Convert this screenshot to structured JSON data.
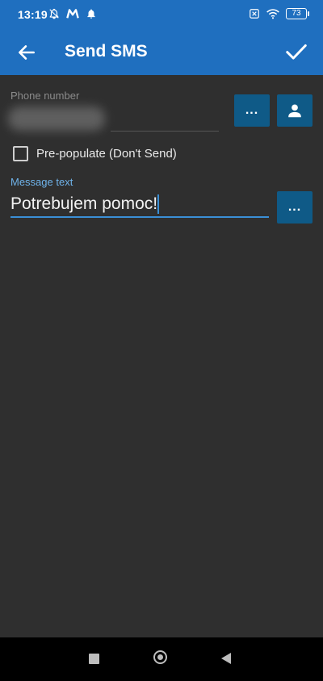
{
  "status": {
    "time": "13:19",
    "battery": "73",
    "icons_left": [
      "bell-off-icon",
      "m-logo-icon",
      "bell-icon"
    ],
    "icons_right": [
      "box-x-icon",
      "wifi-icon",
      "battery-icon"
    ]
  },
  "app_bar": {
    "title": "Send SMS",
    "back_icon": "arrow-left-icon",
    "confirm_icon": "check-icon",
    "color": "#1f6fbf"
  },
  "phone": {
    "label": "Phone number",
    "more_label": "...",
    "contact_icon": "person-icon"
  },
  "prepopulate": {
    "label": "Pre-populate (Don't Send)",
    "checked": false
  },
  "message": {
    "label": "Message text",
    "value": "Potrebujem pomoc!",
    "more_label": "..."
  },
  "nav": {
    "icons": [
      "square-recent-icon",
      "circle-home-icon",
      "triangle-back-icon"
    ]
  },
  "colors": {
    "accent": "#3a8fd6",
    "button_bg": "#0f5a87",
    "background": "#2f2f2f"
  }
}
